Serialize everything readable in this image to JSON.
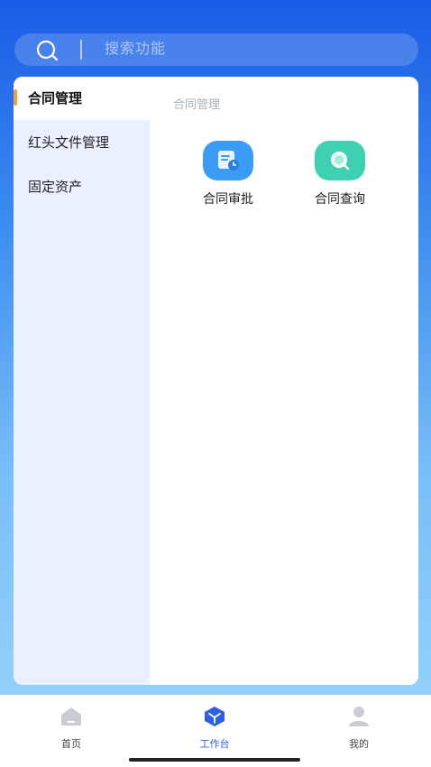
{
  "search": {
    "placeholder": "搜索功能"
  },
  "sidebar": {
    "items": [
      {
        "label": "合同管理",
        "active": true
      },
      {
        "label": "红头文件管理",
        "active": false
      },
      {
        "label": "固定资产",
        "active": false
      }
    ]
  },
  "main": {
    "section_title": "合同管理",
    "apps": [
      {
        "label": "合同审批",
        "icon": "document-clock-icon",
        "color": "#3a9cf5"
      },
      {
        "label": "合同查询",
        "icon": "magnifier-icon",
        "color": "#3ed0b0"
      }
    ]
  },
  "tabbar": {
    "tabs": [
      {
        "label": "首页",
        "icon": "home-icon",
        "active": false
      },
      {
        "label": "工作台",
        "icon": "cube-icon",
        "active": true
      },
      {
        "label": "我的",
        "icon": "user-icon",
        "active": false
      }
    ]
  },
  "colors": {
    "accent": "#2d5fe0",
    "indicator": "#f0a23a",
    "sidebar_bg": "#eaf0ff"
  }
}
